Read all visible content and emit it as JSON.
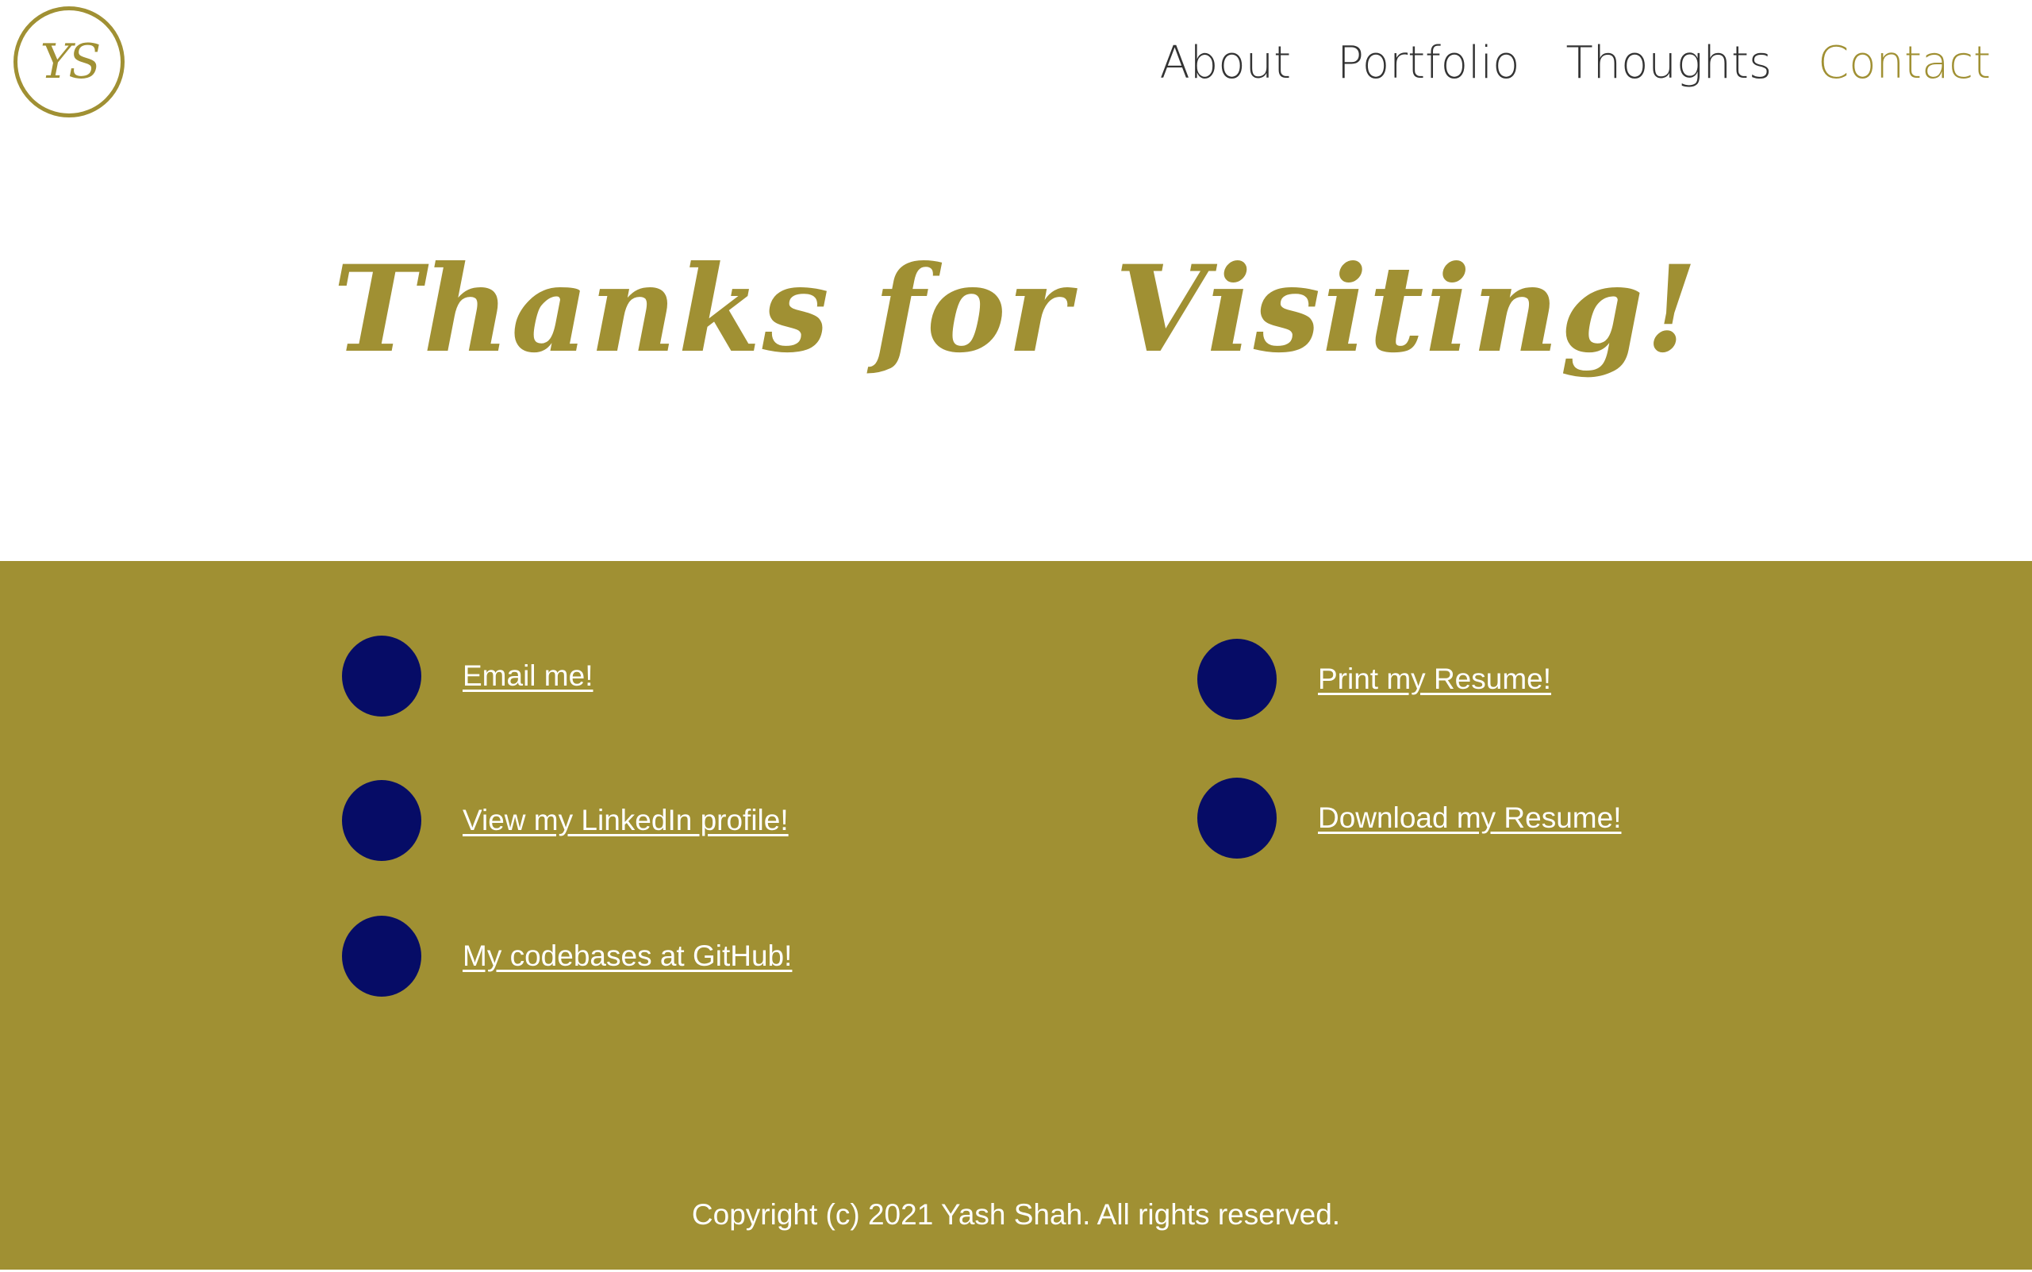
{
  "header": {
    "logo_text": "YS",
    "nav": [
      {
        "label": "About"
      },
      {
        "label": "Portfolio"
      },
      {
        "label": "Thoughts"
      },
      {
        "label": "Contact"
      }
    ]
  },
  "hero": {
    "title": "Thanks for Visiting!"
  },
  "links": {
    "left": [
      {
        "label": "Email me!",
        "icon": "email-icon"
      },
      {
        "label": "View my LinkedIn profile!",
        "icon": "linkedin-icon"
      },
      {
        "label": "My codebases at GitHub!",
        "icon": "github-icon"
      }
    ],
    "right": [
      {
        "label": "Print my Resume!",
        "icon": "print-icon"
      },
      {
        "label": "Download my Resume!",
        "icon": "download-icon"
      }
    ]
  },
  "footer": {
    "copyright": "Copyright (c) 2021 Yash Shah. All rights reserved."
  },
  "colors": {
    "accent": "#a09033",
    "icon_circle": "#060c66",
    "nav_text": "#333333",
    "link_text": "#ffffff"
  }
}
